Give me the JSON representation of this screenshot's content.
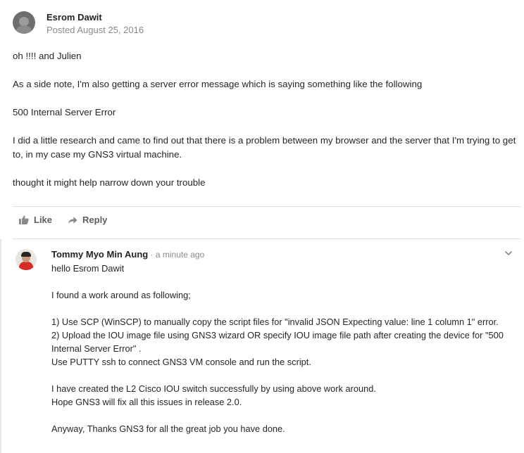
{
  "post": {
    "author": "Esrom Dawit",
    "date": "Posted August 25, 2016",
    "paragraphs": [
      "oh !!!! and Julien",
      "As a side note, I'm also getting a server error message which is saying something like the following",
      "500 Internal Server Error",
      "I did a little research and came to find out that there is a problem between my browser and the server that I'm trying to get to, in my case my GNS3 virtual machine.",
      "thought it might help narrow down your trouble"
    ]
  },
  "actions": {
    "like_label": "Like",
    "reply_label": "Reply"
  },
  "reply": {
    "author": "Tommy Myo Min Aung",
    "separator": " · ",
    "time": "a minute ago",
    "greeting": "hello Esrom Dawit",
    "intro": "I found a work around as following;",
    "step1": "1) Use SCP (WinSCP) to manually copy the script files for \"invalid JSON Expecting value: line 1 column 1\" error.",
    "step2_a": "2) Upload the IOU image file using GNS3 wizard OR specify IOU image file path after creating the device for \"500",
    "step2_b": "Internal Server Error\" .",
    "step3": "Use PUTTY ssh to connect GNS3 VM console and run the script.",
    "result_a": "I have created the L2 Cisco IOU switch successfully by using above work around.",
    "result_b": "Hope GNS3 will fix all this issues in release 2.0.",
    "thanks": "Anyway, Thanks GNS3 for all the great job you have done."
  },
  "icons": {
    "avatar": "user-avatar",
    "like": "thumbs-up-icon",
    "reply": "reply-arrow-icon",
    "menu": "chevron-down-icon"
  },
  "colors": {
    "muted": "#8a8a8a",
    "action": "#5e5e5e",
    "divider": "#e2e2e2",
    "text": "#262626"
  }
}
